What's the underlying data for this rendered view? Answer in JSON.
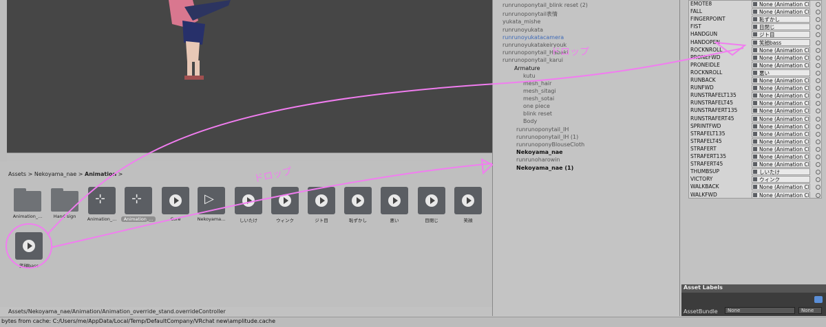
{
  "project": {
    "breadcrumb": [
      "Assets",
      "Nekoyama_nae",
      "Animation"
    ],
    "assets": [
      {
        "kind": "folder",
        "label": "Animation_..."
      },
      {
        "kind": "folder",
        "label": "Hand sign"
      },
      {
        "kind": "controller",
        "label": "Animation_..."
      },
      {
        "kind": "controller",
        "label": "Animation_..."
      },
      {
        "kind": "anim",
        "label": "Core"
      },
      {
        "kind": "blend",
        "label": "Nekoyama..."
      },
      {
        "kind": "anim",
        "label": "しいたけ"
      },
      {
        "kind": "anim",
        "label": "ウィンク"
      },
      {
        "kind": "anim",
        "label": "ジト目"
      },
      {
        "kind": "anim",
        "label": "恥ずかし"
      },
      {
        "kind": "anim",
        "label": "悪い"
      },
      {
        "kind": "anim",
        "label": "目閉じ"
      },
      {
        "kind": "anim",
        "label": "笑顔"
      },
      {
        "kind": "anim",
        "label": "笑顔bass"
      }
    ],
    "selected_path": "Assets/Nekoyama_nae/Animation/Animation_override_stand.overrideController"
  },
  "status": {
    "message": "bytes from cache: C:/Users/me/AppData/Local/Temp/DefaultCompany/VRchat new\\amplitude.cache"
  },
  "hierarchy": [
    "runrunoponytail_blink reset (2)",
    "runrunoponytail表情",
    "yukata_mishe",
    "runrunoyukata",
    "runrunoyukatacamera",
    "runrunoyukatakeiryouk",
    "runrunoponytail_Habaki",
    "runrunoponytail_karui",
    "Armature",
    "kutu",
    "mesh_hair",
    "mesh_sitagi",
    "mesh_sotai",
    "one piece",
    "blink reset",
    "Body",
    "runrunoponytail_IH",
    "runrunoponytail_IH (1)",
    "runrunoponyBlouseCloth",
    "Nekoyama_nae",
    "runrunoharowin",
    "Nekoyama_nae (1)"
  ],
  "inspector": {
    "rows": [
      {
        "name": "EMOTE8",
        "value": "None (Animation Cl"
      },
      {
        "name": "FALL",
        "value": "None (Animation Cl"
      },
      {
        "name": "FINGERPOINT",
        "value": "恥ずかし"
      },
      {
        "name": "FIST",
        "value": "目閉じ"
      },
      {
        "name": "HANDGUN",
        "value": "ジト目"
      },
      {
        "name": "HANDOPEN",
        "value": "笑顔bass"
      },
      {
        "name": "ROCKNROLL",
        "value": "None (Animation Cl"
      },
      {
        "name": "PRONEFWD",
        "value": "None (Animation Cl"
      },
      {
        "name": "PRONEIDLE",
        "value": "None (Animation Cl"
      },
      {
        "name": "ROCKNROLL",
        "value": "悪い"
      },
      {
        "name": "RUNBACK",
        "value": "None (Animation Cl"
      },
      {
        "name": "RUNFWD",
        "value": "None (Animation Cl"
      },
      {
        "name": "RUNSTRAFELT135",
        "value": "None (Animation Cl"
      },
      {
        "name": "RUNSTRAFELT45",
        "value": "None (Animation Cl"
      },
      {
        "name": "RUNSTRAFERT135",
        "value": "None (Animation Cl"
      },
      {
        "name": "RUNSTRAFERT45",
        "value": "None (Animation Cl"
      },
      {
        "name": "SPRINTFWD",
        "value": "None (Animation Cl"
      },
      {
        "name": "STRAFELT135",
        "value": "None (Animation Cl"
      },
      {
        "name": "STRAFELT45",
        "value": "None (Animation Cl"
      },
      {
        "name": "STRAFERT",
        "value": "None (Animation Cl"
      },
      {
        "name": "STRAFERT135",
        "value": "None (Animation Cl"
      },
      {
        "name": "STRAFERT45",
        "value": "None (Animation Cl"
      },
      {
        "name": "THUMBSUP",
        "value": "しいたけ"
      },
      {
        "name": "VICTORY",
        "value": "ウィンク"
      },
      {
        "name": "WALKBACK",
        "value": "None (Animation Cl"
      },
      {
        "name": "WALKFWD",
        "value": "None (Animation Cl"
      }
    ],
    "asset_labels_title": "Asset Labels",
    "asset_bundle_label": "AssetBundle",
    "asset_bundle_value": "None",
    "asset_variant_value": "None"
  },
  "annotations": {
    "drop_text_1": "ドロップ",
    "drop_text_2": "ドロップ"
  },
  "colors": {
    "annotation": "#f17df0",
    "selected_label": "#8e8e8e"
  }
}
